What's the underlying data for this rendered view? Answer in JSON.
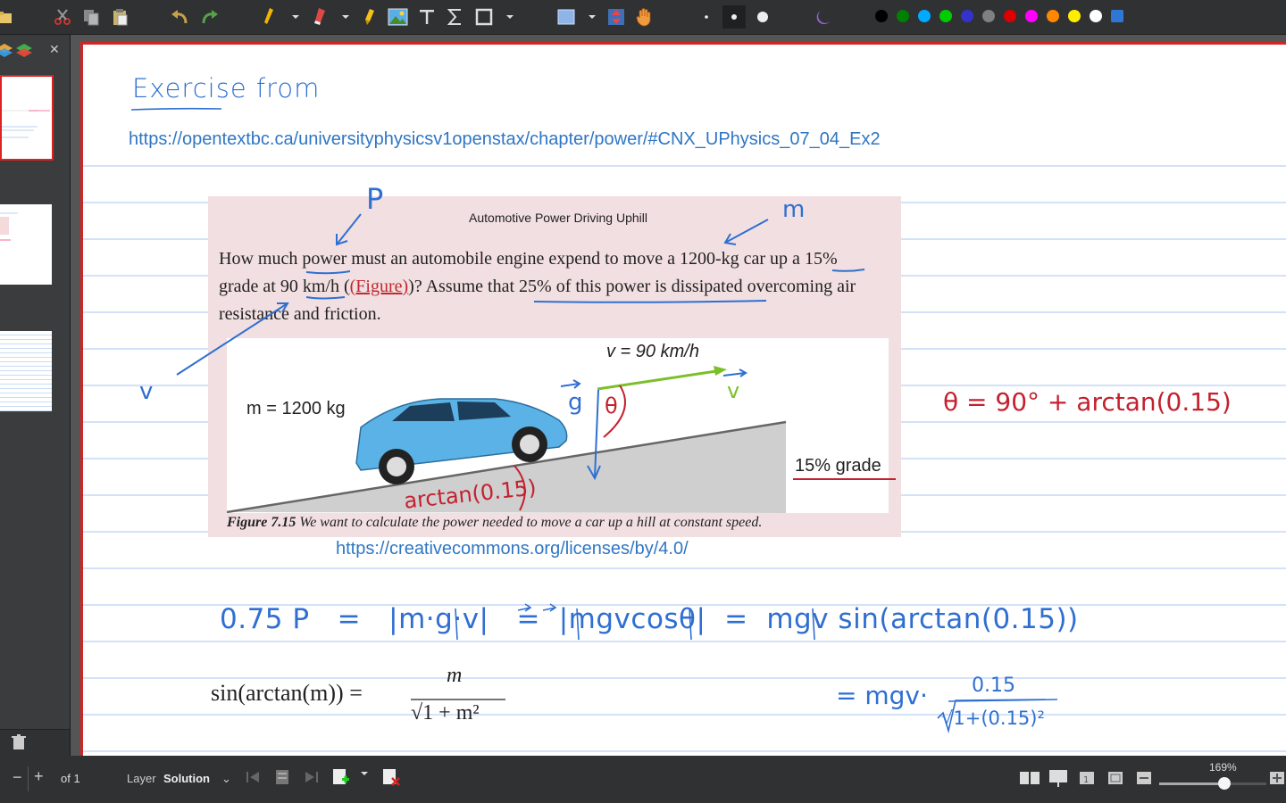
{
  "status": {
    "page_of": "of 1",
    "layer_label": "Layer",
    "layer_name": "Solution",
    "zoom": "169%"
  },
  "colors": [
    "#000000",
    "#008000",
    "#00aaff",
    "#00cc00",
    "#3333cc",
    "#808080",
    "#dd0000",
    "#ff00ff",
    "#ff8800",
    "#ffee00",
    "#ffffff"
  ],
  "page": {
    "heading": "Exercise from",
    "source_url": "https://opentextbc.ca/universityphysicsv1openstax/chapter/power/#CNX_UPhysics_07_04_Ex2",
    "exercise_title": "Automotive Power Driving Uphill",
    "question_line1": "How much power must an automobile engine expend to move a 1200-kg car up a 15%",
    "question_line2_a": "grade at 90 km/h (",
    "question_link": "(Figure)",
    "question_line2_b": ")? Assume that 25% of this power is dissipated overcoming air",
    "question_line3": "resistance and friction.",
    "figure_v": "v = 90 km/h",
    "figure_m": "m = 1200 kg",
    "figure_grade": "15% grade",
    "caption_bold": "Figure 7.15",
    "caption_text": " We want to calculate the power needed to move a car up a hill at constant speed.",
    "license_url": "https://creativecommons.org/licenses/by/4.0/",
    "ann_p": "P",
    "ann_m": "m",
    "ann_v": "v",
    "ann_g": "g",
    "ann_theta": "θ",
    "ann_vvec": "v",
    "ann_arctan": "arctan(0.15)",
    "theta_eq": "θ = 90° + arctan(0.15)",
    "eq1": "0.75 P   =   |m·g·v|   =  |mgvcosθ|  =  mgv sin(arctan(0.15))",
    "identity_lhs": "sin(arctan(m)) = ",
    "identity_num": "m",
    "identity_den": "√1 + m²",
    "eq2_prefix": "= mgv·",
    "eq2_num": "0.15",
    "eq2_den": "√1+(0.15)²"
  }
}
